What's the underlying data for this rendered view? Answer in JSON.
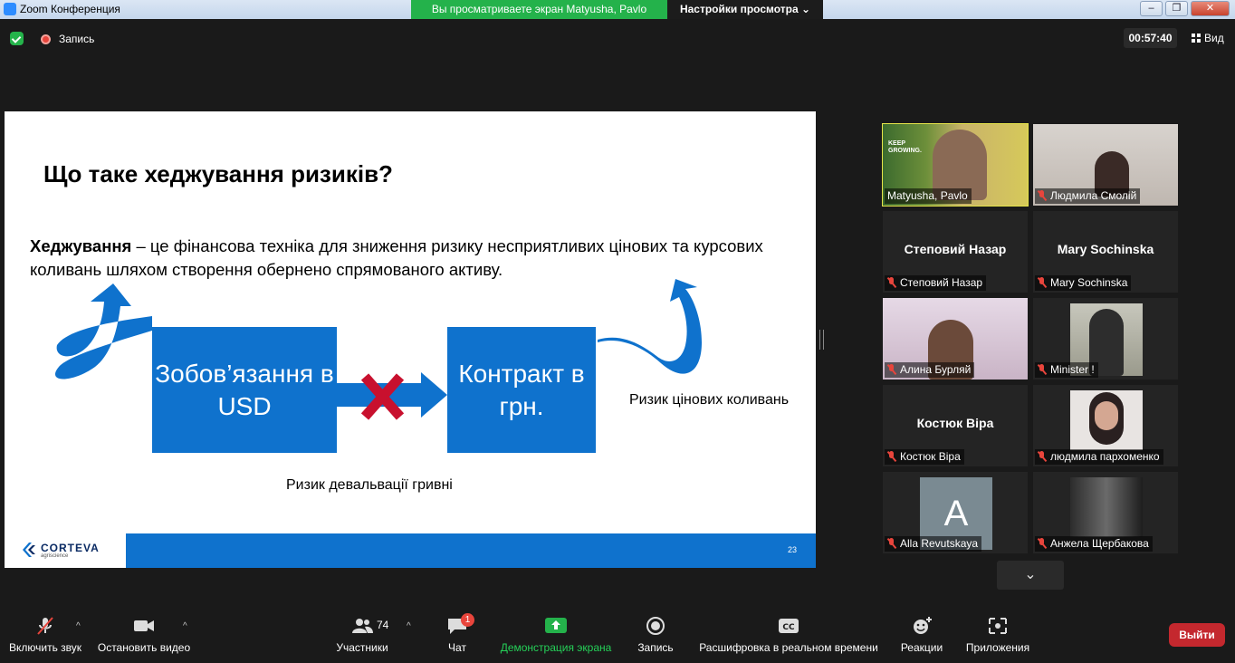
{
  "window": {
    "title": "Zoom Конференция",
    "share_banner": "Вы просматриваете экран Matyusha, Pavlo",
    "view_options": "Настройки просмотра"
  },
  "topbar": {
    "recording_label": "Запись",
    "timer": "00:57:40",
    "view_label": "Вид"
  },
  "slide": {
    "title": "Що таке хеджування ризиків?",
    "definition_term": "Хеджування",
    "definition_text": " – це фінансова техніка для зниження ризику несприятливих цінових та курсових коливань шляхом створення обернено спрямованого активу.",
    "box_left": "Зобов’язання в USD",
    "box_right": "Контракт в грн.",
    "risk_price": "Ризик цінових коливань",
    "risk_devaluation": "Ризик девальвації гривні",
    "logo_text": "CORTEVA",
    "logo_sub": "agriscience",
    "page_number": "23"
  },
  "participants": [
    {
      "display": "",
      "label": "Matyusha, Pavlo",
      "muted": false
    },
    {
      "display": "",
      "label": "Людмила Смолій",
      "muted": true
    },
    {
      "display": "Степовий Назар",
      "label": "Степовий Назар",
      "muted": true
    },
    {
      "display": "Mary Sochinska",
      "label": "Mary Sochinska",
      "muted": true
    },
    {
      "display": "",
      "label": "Алина Бурляй",
      "muted": true
    },
    {
      "display": "",
      "label": "Minister !",
      "muted": true
    },
    {
      "display": "Костюк Віра",
      "label": "Костюк Віра",
      "muted": true
    },
    {
      "display": "",
      "label": "людмила пархоменко",
      "muted": true
    },
    {
      "display": "A",
      "label": "Alla Revutskaya",
      "muted": true
    },
    {
      "display": "",
      "label": "Анжела Щербакова",
      "muted": true
    }
  ],
  "toolbar": {
    "unmute": "Включить звук",
    "stop_video": "Остановить видео",
    "participants": "Участники",
    "participants_count": "74",
    "chat": "Чат",
    "chat_badge": "1",
    "share": "Демонстрация экрана",
    "record": "Запись",
    "transcript": "Расшифровка в реальном времени",
    "reactions": "Реакции",
    "apps": "Приложения",
    "leave": "Выйти"
  },
  "colors": {
    "slide_blue": "#0f72cd",
    "share_green": "#24b24b",
    "leave_red": "#c4282e"
  }
}
